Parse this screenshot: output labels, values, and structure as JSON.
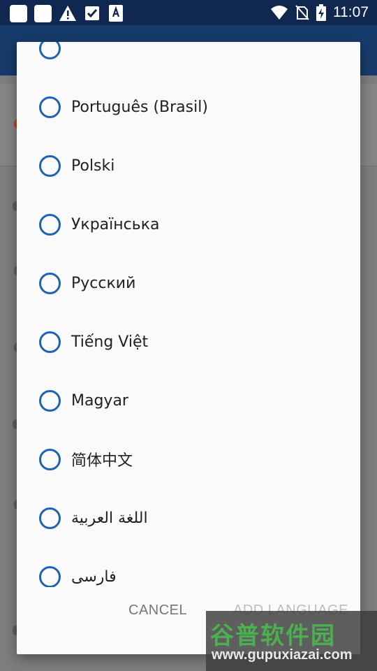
{
  "status_bar": {
    "time": "11:07",
    "icons": [
      "notification-icon",
      "notification-icon",
      "warning-icon",
      "checkbox-icon",
      "font-icon",
      "wifi-icon",
      "no-sim-icon",
      "battery-charging-icon"
    ]
  },
  "dialog": {
    "languages": [
      {
        "label": ""
      },
      {
        "label": "Português (Brasil)"
      },
      {
        "label": "Polski"
      },
      {
        "label": "Українська"
      },
      {
        "label": "Русский"
      },
      {
        "label": "Tiếng Việt"
      },
      {
        "label": "Magyar"
      },
      {
        "label": "简体中文"
      },
      {
        "label": "اللغة العربية"
      },
      {
        "label": "فارسی"
      }
    ],
    "cancel_label": "CANCEL",
    "add_label": "ADD LANGUAGE"
  },
  "watermark": {
    "logo": "谷普软件园",
    "url": "www.gupuxiazai.com"
  },
  "colors": {
    "accent": "#1e63b5",
    "status_bar": "#10284f",
    "dialog_bg": "#fafafa"
  }
}
